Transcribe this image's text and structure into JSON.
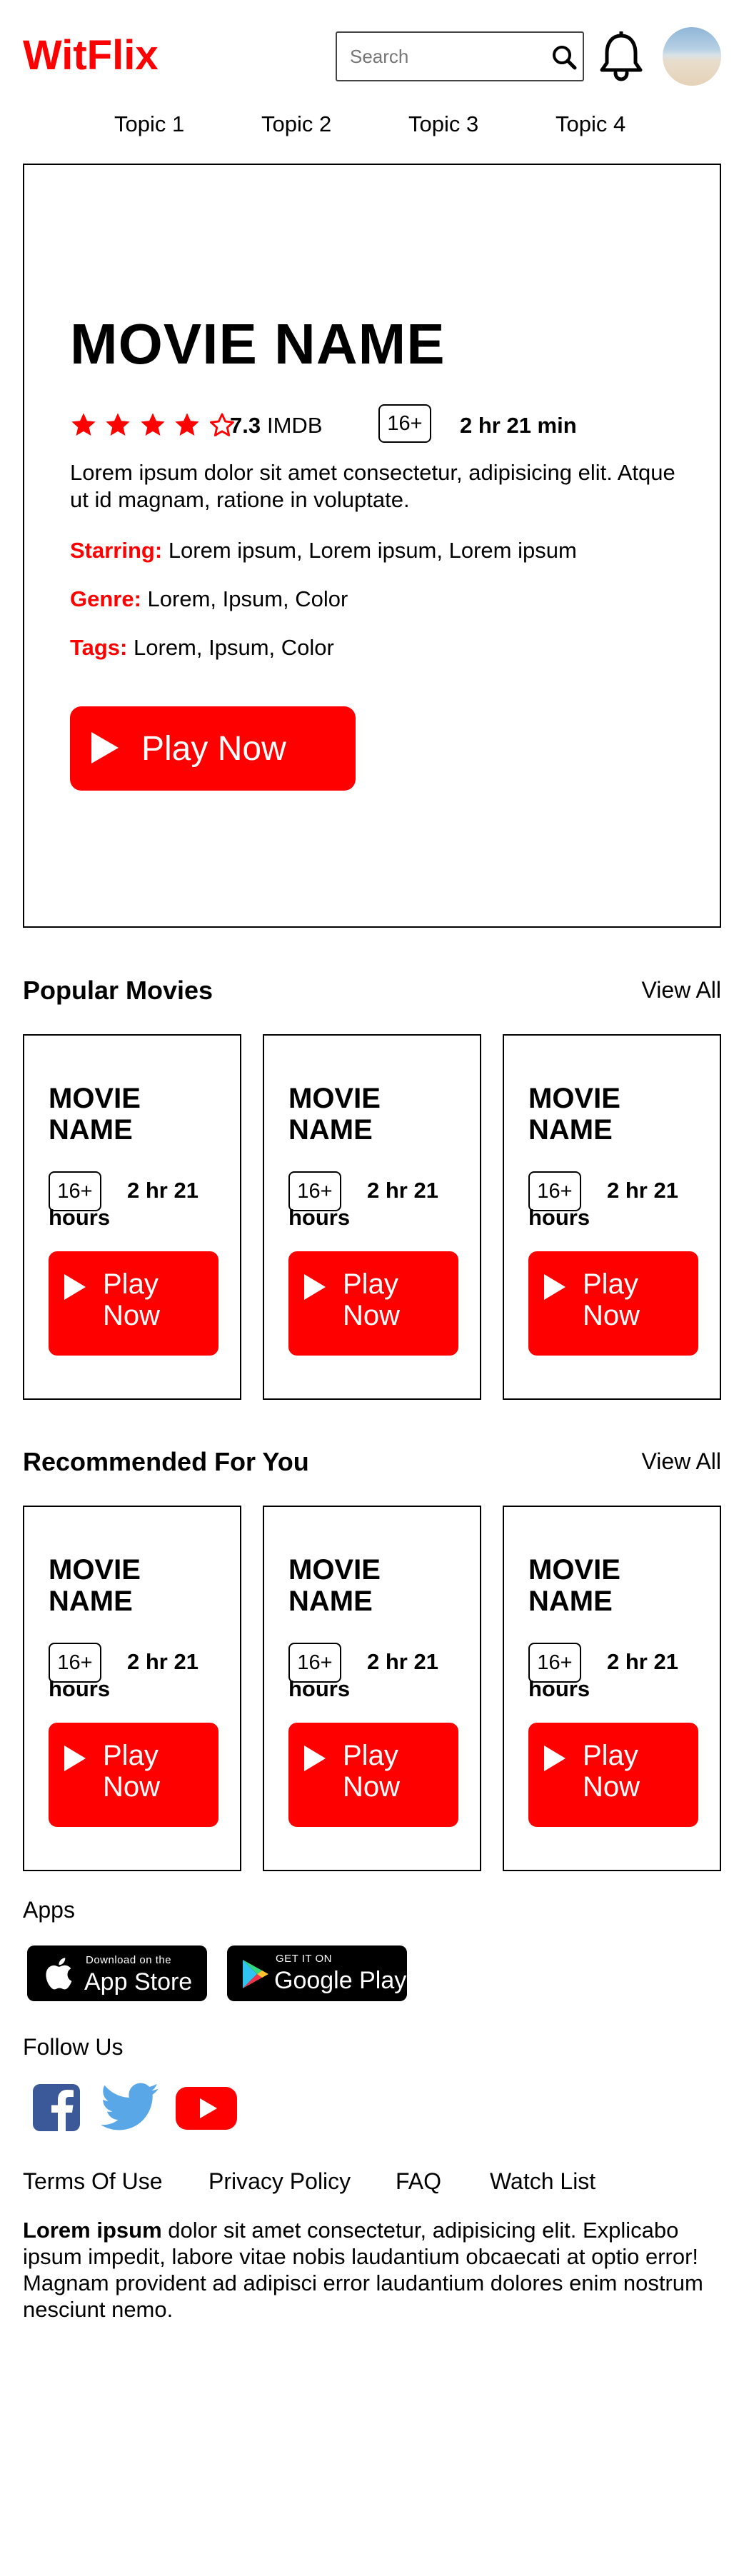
{
  "header": {
    "logo": "WitFlix",
    "search_placeholder": "Search",
    "topics": [
      "Topic 1",
      "Topic 2",
      "Topic 3",
      "Topic 4"
    ]
  },
  "hero": {
    "title": "MOVIE NAME",
    "stars_filled": 4,
    "stars_total": 5,
    "rating": "7.3",
    "rating_source": "IMDB",
    "age": "16+",
    "duration": "2 hr 21 min",
    "description": "Lorem ipsum dolor sit amet consectetur, adipisicing elit. Atque ut id magnam, ratione in voluptate.",
    "starring_label": "Starring:",
    "starring": "Lorem ipsum, Lorem ipsum, Lorem ipsum",
    "genre_label": "Genre:",
    "genre": "Lorem, Ipsum, Color",
    "tags_label": "Tags:",
    "tags": "Lorem, Ipsum, Color",
    "play_label": "Play Now"
  },
  "popular": {
    "title": "Popular Movies",
    "view_all": "View All",
    "cards": [
      {
        "title": "MOVIE NAME",
        "age": "16+",
        "duration": "2 hr 21 hours",
        "play": "Play Now"
      },
      {
        "title": "MOVIE NAME",
        "age": "16+",
        "duration": "2 hr 21 hours",
        "play": "Play Now"
      },
      {
        "title": "MOVIE NAME",
        "age": "16+",
        "duration": "2 hr 21 hours",
        "play": "Play Now"
      }
    ]
  },
  "recommended": {
    "title": "Recommended For You",
    "view_all": "View All",
    "cards": [
      {
        "title": "MOVIE NAME",
        "age": "16+",
        "duration": "2 hr 21 hours",
        "play": "Play Now"
      },
      {
        "title": "MOVIE NAME",
        "age": "16+",
        "duration": "2 hr 21 hours",
        "play": "Play Now"
      },
      {
        "title": "MOVIE NAME",
        "age": "16+",
        "duration": "2 hr 21 hours",
        "play": "Play Now"
      }
    ]
  },
  "footer": {
    "apps_label": "Apps",
    "app_store_small": "Download on the",
    "app_store_big": "App Store",
    "google_small": "GET IT ON",
    "google_big": "Google Play",
    "follow_label": "Follow Us",
    "social_icons": [
      "facebook-icon",
      "twitter-icon",
      "youtube-icon"
    ],
    "links": [
      "Terms Of Use",
      "Privacy Policy",
      "FAQ",
      "Watch List"
    ],
    "text_bold": "Lorem ipsum",
    "text": " dolor sit amet consectetur, adipisicing elit. Explicabo ipsum impedit, labore vitae nobis laudantium obcaecati at optio error! Magnam provident ad adipisci error laudantium dolores enim nostrum nesciunt nemo."
  },
  "colors": {
    "brand": "#ff0000",
    "facebook": "#3b5998",
    "twitter": "#5aa7e8",
    "youtube": "#ff0000"
  }
}
